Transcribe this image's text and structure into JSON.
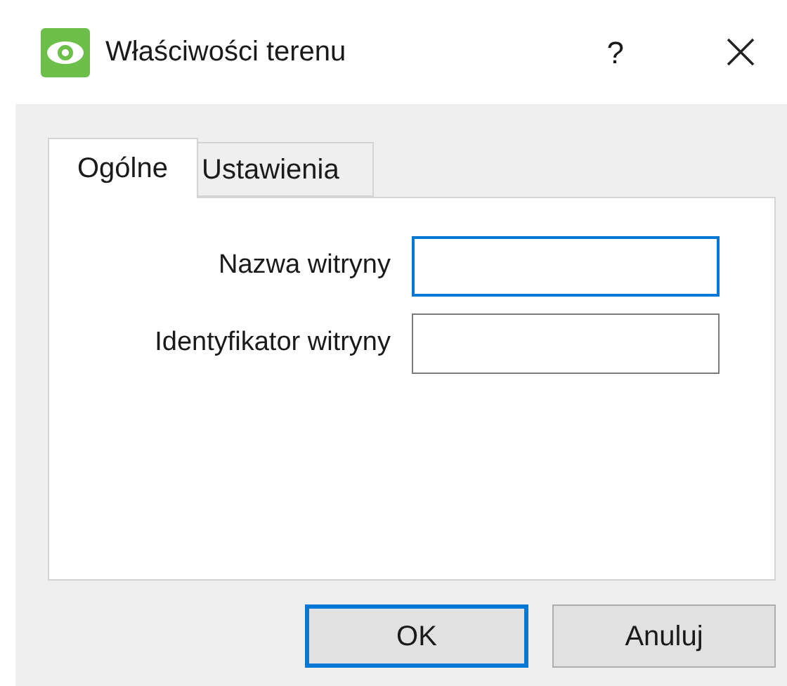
{
  "window": {
    "title": "Właściwości terenu",
    "help": "?"
  },
  "tabs": [
    {
      "label": "Ogólne",
      "selected": true
    },
    {
      "label": "Ustawienia",
      "selected": false
    }
  ],
  "fields": [
    {
      "label": "Nazwa witryny",
      "focused": true
    },
    {
      "label": "Identyfikator witryny",
      "focused": false
    }
  ],
  "buttons": [
    {
      "label": "OK",
      "default": true
    },
    {
      "label": "Anuluj",
      "default": false
    }
  ]
}
